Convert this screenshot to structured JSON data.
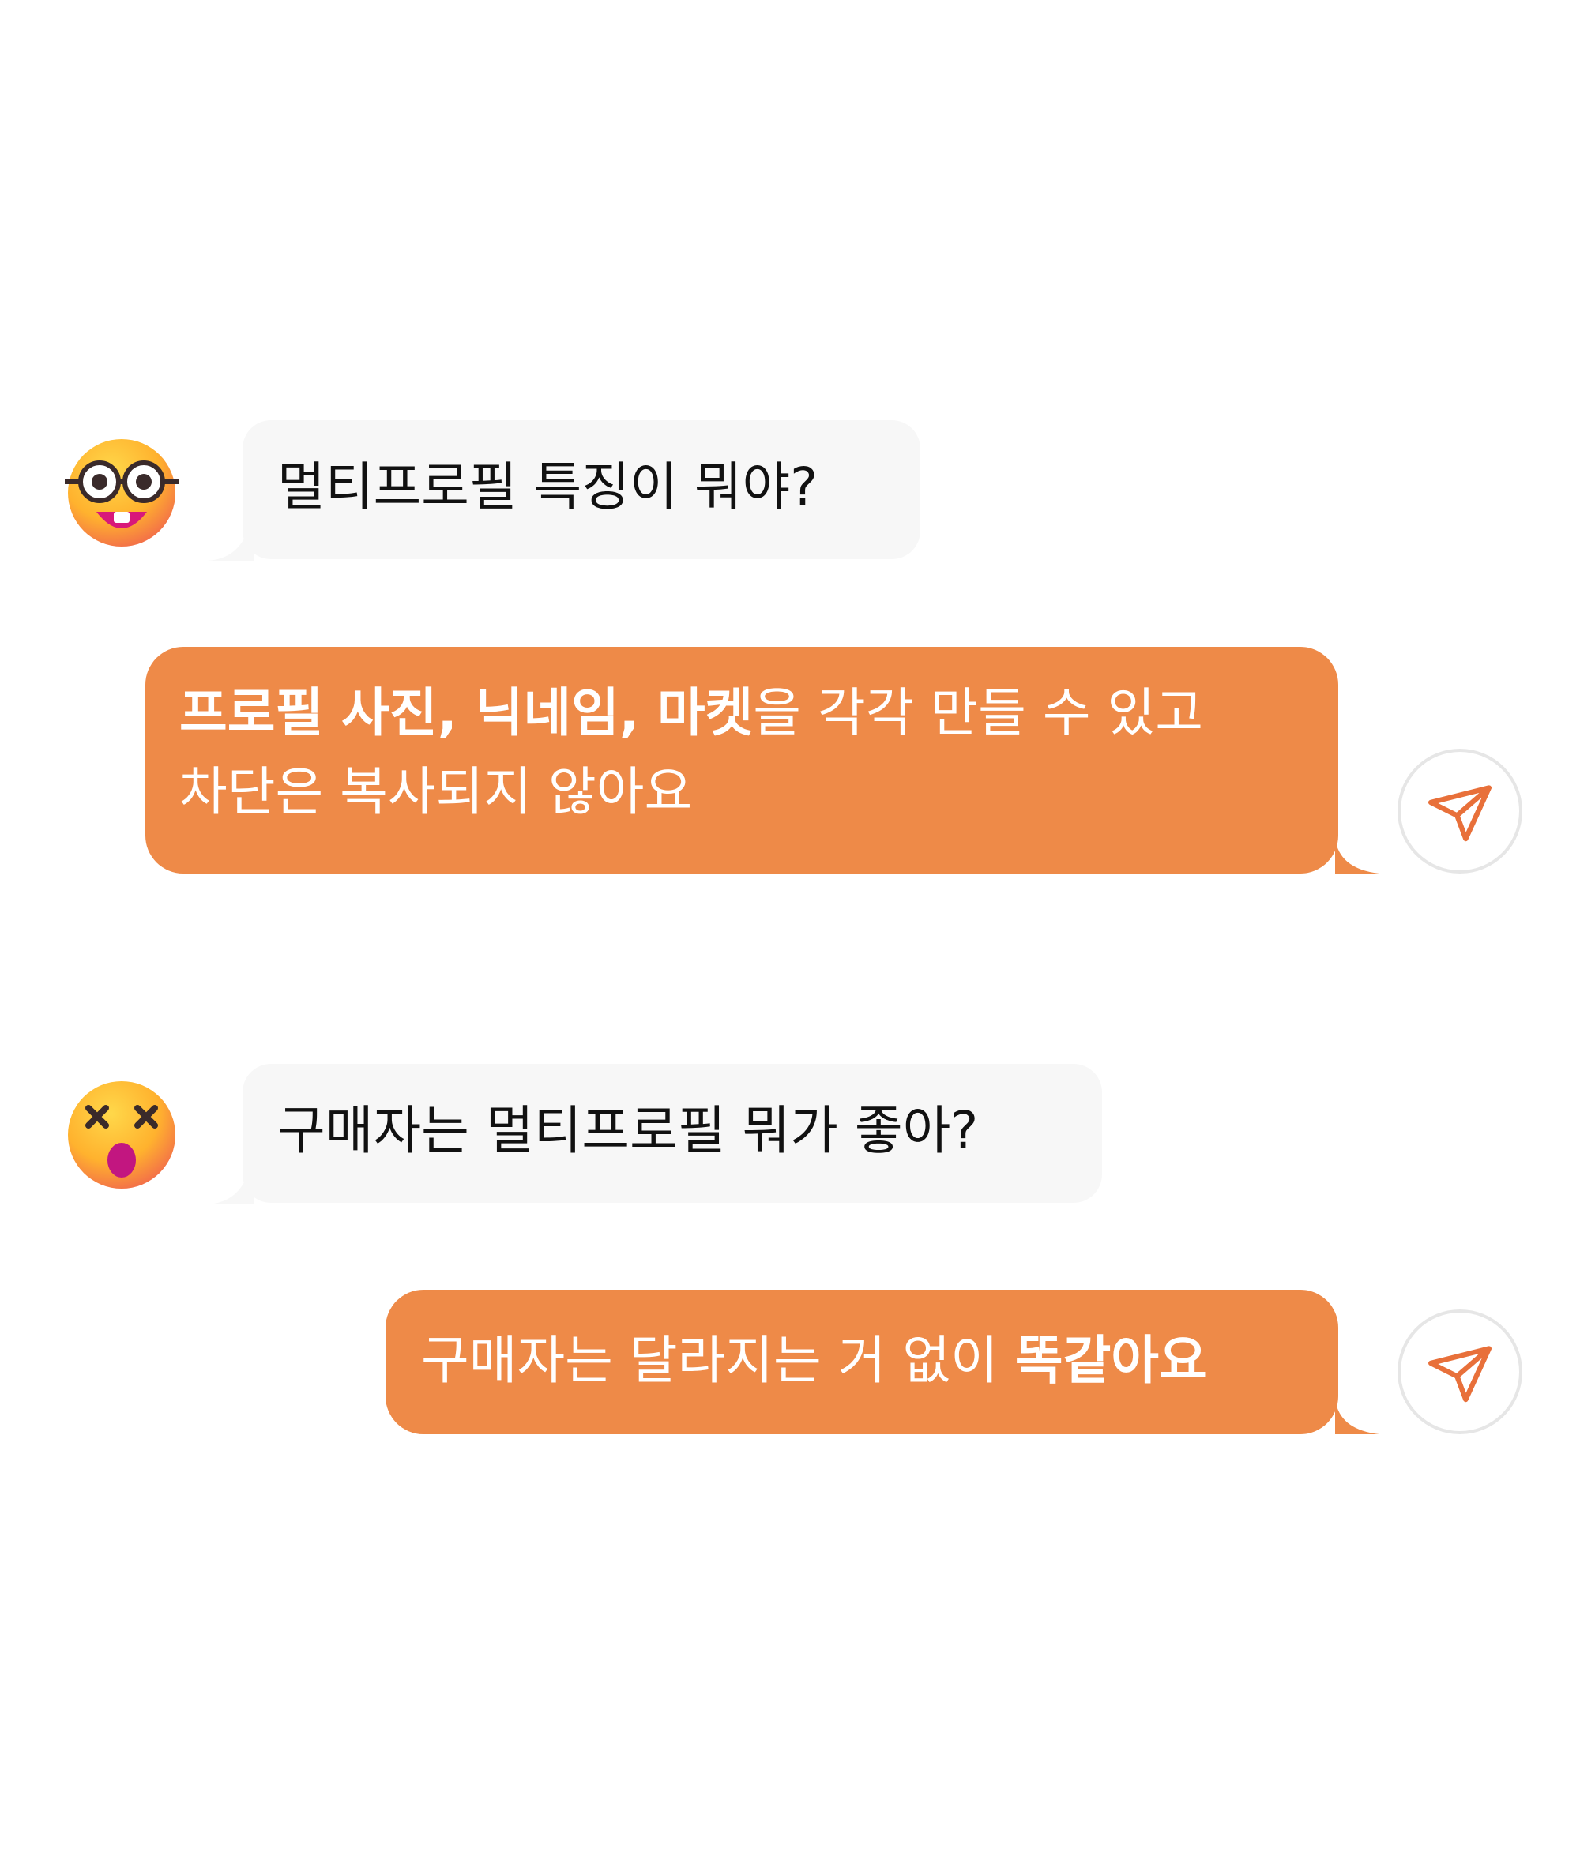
{
  "colors": {
    "background": "#ffffff",
    "incoming_bubble": "#f7f7f7",
    "outgoing_bubble": "#ee8a48",
    "outgoing_text": "#ffffff",
    "incoming_text": "#111111",
    "send_icon": "#e8703a",
    "send_button_border": "#e6e6e6"
  },
  "conversation": [
    {
      "role": "incoming",
      "avatar_icon": "nerd-face-with-glasses-emoji",
      "text": "멀티프로필 특징이 뭐야?"
    },
    {
      "role": "outgoing",
      "lines": [
        {
          "bold": "프로필 사진, 닉네임, 마켓",
          "regular": "을 각각 만들 수 있고"
        },
        {
          "regular": "차단은 복사되지 않아요"
        }
      ],
      "action_icon": "paper-plane-send-icon"
    },
    {
      "role": "incoming",
      "avatar_icon": "dizzy-face-emoji",
      "text": "구매자는 멀티프로필 뭐가 좋아?"
    },
    {
      "role": "outgoing",
      "lines": [
        {
          "regular": "구매자는 달라지는 거 없이 ",
          "bold": "똑같아요"
        }
      ],
      "action_icon": "paper-plane-send-icon"
    }
  ]
}
